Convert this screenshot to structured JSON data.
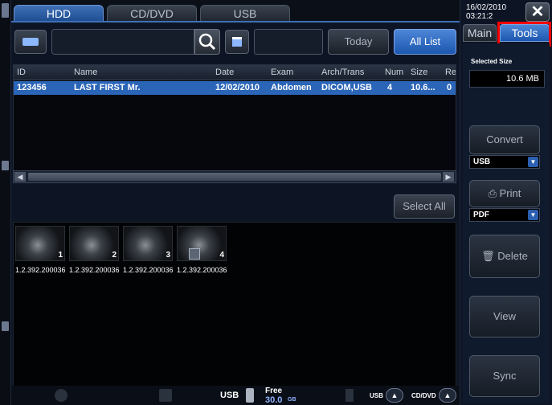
{
  "tabs": [
    {
      "label": "HDD",
      "active": true
    },
    {
      "label": "CD/DVD",
      "active": false
    },
    {
      "label": "USB",
      "active": false
    }
  ],
  "search": {
    "placeholder": "",
    "value": ""
  },
  "filter_buttons": {
    "today": "Today",
    "all_list": "All List"
  },
  "table": {
    "columns": [
      "ID",
      "Name",
      "Date",
      "Exam",
      "Arch/Trans",
      "Num",
      "Size",
      "Re"
    ],
    "rows": [
      {
        "id": "123456",
        "name": "LAST FIRST  Mr.",
        "date": "12/02/2010",
        "exam": "Abdomen",
        "arch": "DICOM,USB",
        "num": "4",
        "size": "10.6...",
        "re": "0"
      }
    ]
  },
  "select_all": "Select All",
  "thumbnails": [
    {
      "num": "1",
      "label": "1.2.392.200036"
    },
    {
      "num": "2",
      "label": "1.2.392.200036"
    },
    {
      "num": "3",
      "label": "1.2.392.200036"
    },
    {
      "num": "4",
      "label": "1.2.392.200036"
    }
  ],
  "status": {
    "usb": "USB",
    "free_label": "Free",
    "free_value": "30.0",
    "free_unit": "GB",
    "usb_eject": "USB",
    "cddvd_eject": "CD/DVD"
  },
  "right": {
    "date": "16/02/2010",
    "time": "03:21:2",
    "tab_main": "Main",
    "tab_tools": "Tools",
    "selected_size_label": "Selected Size",
    "selected_size_value": "10.6 MB",
    "convert": "Convert",
    "convert_format": "USB",
    "print": "Print",
    "print_format": "PDF",
    "delete": "Delete",
    "view": "View",
    "sync": "Sync"
  },
  "colors": {
    "accent": "#3f70b7",
    "highlight": "#ff0000",
    "row_selected": "#2b65b8"
  }
}
